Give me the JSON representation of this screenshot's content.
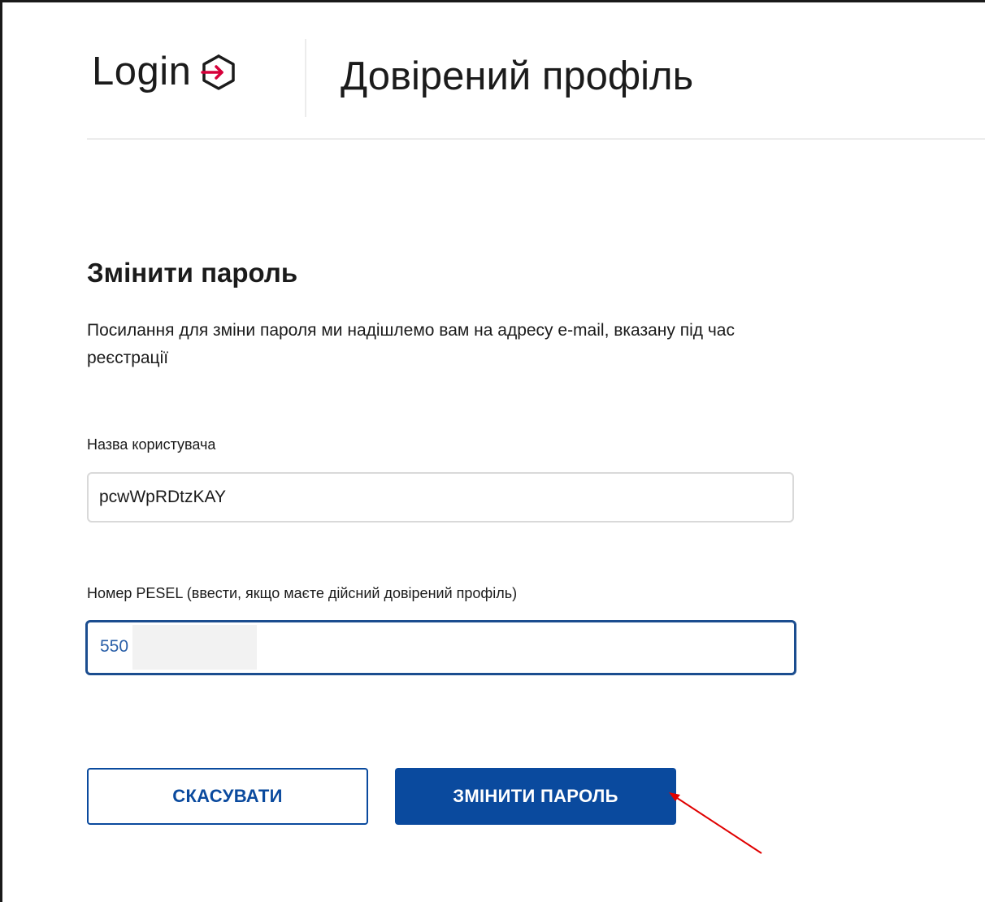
{
  "header": {
    "logo_text": "Login",
    "logo_icon": "login-arrow-icon",
    "title": "Довірений профіль"
  },
  "form": {
    "heading": "Змінити пароль",
    "description": "Посилання для зміни пароля ми надішлемо вам на адресу e-mail, вказану під час реєстрації",
    "username": {
      "label": "Назва користувача",
      "value": "pcwWpRDtzKAY"
    },
    "pesel": {
      "label": "Номер PESEL (ввести, якщо маєте дійсний довірений профіль)",
      "value": "550"
    },
    "cancel_label": "СКАСУВАТИ",
    "submit_label": "ЗМІНИТИ ПАРОЛЬ"
  },
  "colors": {
    "brand_blue": "#0a4a9e",
    "focus_border": "#1b4d8f",
    "logo_accent": "#d6003a",
    "annotation_arrow": "#e00000"
  }
}
